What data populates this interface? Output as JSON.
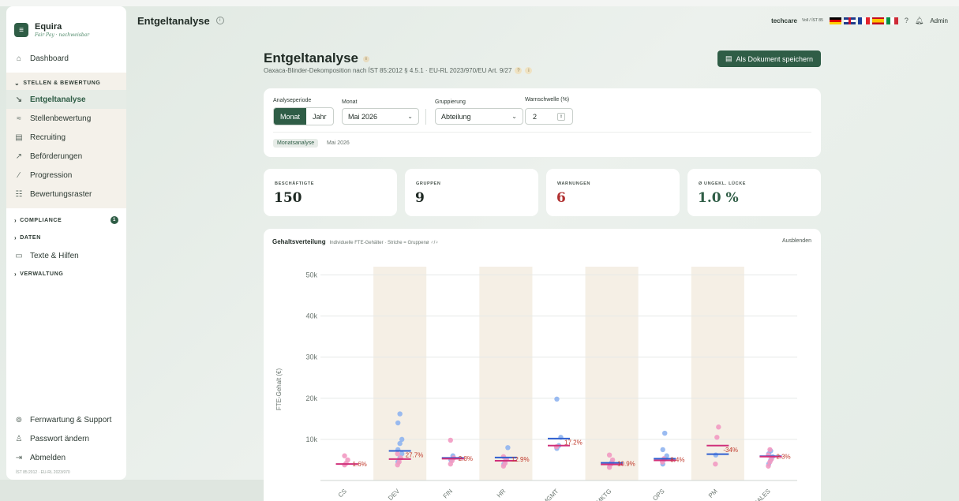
{
  "app": {
    "name": "Equira",
    "tagline": "Fair Pay · nachweisbar",
    "logo_glyph": "≡"
  },
  "topbar": {
    "title": "Entgeltanalyse",
    "tenant": "techcare",
    "norm": "Voll / ÍST 85",
    "help": "?",
    "user": "Admin",
    "flags": [
      "de",
      "gb",
      "fr",
      "es",
      "it"
    ]
  },
  "sidebar": {
    "dashboard": "Dashboard",
    "group_stellen": "STELLEN & BEWERTUNG",
    "items": [
      {
        "label": "Entgeltanalyse",
        "icon": "chart-icon",
        "glyph": "↘",
        "active": true
      },
      {
        "label": "Stellenbewertung",
        "icon": "layers-icon",
        "glyph": "≈",
        "active": false
      },
      {
        "label": "Recruiting",
        "icon": "briefcase-icon",
        "glyph": "▤",
        "active": false
      },
      {
        "label": "Beförderungen",
        "icon": "trend-up-icon",
        "glyph": "↗",
        "active": false
      },
      {
        "label": "Progression",
        "icon": "slash-icon",
        "glyph": "∕",
        "active": false
      },
      {
        "label": "Bewertungsraster",
        "icon": "grid-icon",
        "glyph": "☷",
        "active": false
      }
    ],
    "compliance": "COMPLIANCE",
    "compliance_badge": "1",
    "daten": "DATEN",
    "texte": "Texte & Hilfen",
    "verwaltung": "VERWALTUNG",
    "support": "Fernwartung & Support",
    "password": "Passwort ändern",
    "logout": "Abmelden",
    "footnote": "ÍST 85:2012 · EU-RL 2023/970"
  },
  "page": {
    "title": "Entgeltanalyse",
    "subtitle": "Oaxaca-Blinder-Dekomposition nach ÍST 85:2012 § 4.5.1 · EU-RL 2023/970/EU Art. 9/27",
    "save_label": "Als Dokument speichern"
  },
  "filters": {
    "period_label": "Analyseperiode",
    "period_options": [
      "Monat",
      "Jahr"
    ],
    "period_selected": "Monat",
    "month_label": "Monat",
    "month_value": "Mai 2026",
    "grouping_label": "Gruppierung",
    "grouping_value": "Abteilung",
    "threshold_label": "Warnschwelle (%)",
    "threshold_value": "2",
    "chip": "Monatsanalyse",
    "chip_text": "Mai 2026"
  },
  "stats": [
    {
      "label": "BESCHÄFTIGTE",
      "value": "150"
    },
    {
      "label": "GRUPPEN",
      "value": "9"
    },
    {
      "label": "WARNUNGEN",
      "value": "6"
    },
    {
      "label": "Ø UNGEKL. LÜCKE",
      "value": "1.0 %"
    }
  ],
  "chart": {
    "title": "Gehaltsverteilung",
    "description": "Individuelle FTE-Gehälter · Striche = Gruppenø ♂/♀",
    "hide_label": "Ausblenden"
  },
  "colors": {
    "accent": "#2f5d46",
    "male": "#2f5fd0",
    "female": "#d0307a",
    "male_point": "#8fb4f0",
    "female_point": "#f29ac2",
    "gap_label": "#c0392b",
    "band": "#f5efe5"
  },
  "chart_data": {
    "type": "scatter",
    "title": "",
    "xlabel": "",
    "ylabel": "FTE-Gehalt (€)",
    "ylim": [
      0,
      52000
    ],
    "yticks": [
      "10k",
      "20k",
      "30k",
      "40k",
      "50k"
    ],
    "ytick_values": [
      10000,
      20000,
      30000,
      40000,
      50000
    ],
    "grid": true,
    "groups": [
      {
        "name": "CS",
        "banded": false,
        "male_mean": null,
        "female_mean": 4000,
        "gap": "1.6%",
        "male_points": [],
        "female_points": [
          3800,
          4200,
          5000,
          6000
        ]
      },
      {
        "name": "DEV",
        "banded": true,
        "male_mean": 7200,
        "female_mean": 5200,
        "gap": "27.7%",
        "male_points": [
          4500,
          5500,
          6500,
          7500,
          9000,
          10000,
          14000,
          16200
        ],
        "female_points": [
          3800,
          4500,
          5500,
          6500
        ]
      },
      {
        "name": "FIN",
        "banded": false,
        "male_mean": 5500,
        "female_mean": 5300,
        "gap": "2.8%",
        "male_points": [
          5000,
          6000
        ],
        "female_points": [
          4000,
          4800,
          5500,
          9800
        ]
      },
      {
        "name": "HR",
        "banded": true,
        "male_mean": 5600,
        "female_mean": 4800,
        "gap": "12.9%",
        "male_points": [
          4000,
          5000,
          8000
        ],
        "female_points": [
          3500,
          4200,
          5200,
          5800
        ]
      },
      {
        "name": "MGMT",
        "banded": false,
        "male_mean": 10200,
        "female_mean": 8500,
        "gap": "17.2%",
        "male_points": [
          7800,
          8500,
          10500,
          19800
        ],
        "female_points": [
          8200
        ]
      },
      {
        "name": "MKTG",
        "banded": true,
        "male_mean": 4300,
        "female_mean": 3900,
        "gap": "10.9%",
        "male_points": [
          3800,
          4400
        ],
        "female_points": [
          3200,
          4000,
          5000,
          6200
        ]
      },
      {
        "name": "OPS",
        "banded": false,
        "male_mean": 5300,
        "female_mean": 4900,
        "gap": "8.4%",
        "male_points": [
          4000,
          5200,
          6000,
          7500,
          11500
        ],
        "female_points": [
          4500,
          5300
        ]
      },
      {
        "name": "PM",
        "banded": true,
        "male_mean": 6400,
        "female_mean": 8500,
        "gap": "-34%",
        "male_points": [
          6200
        ],
        "female_points": [
          4000,
          10500,
          13000
        ]
      },
      {
        "name": "SALES",
        "banded": false,
        "male_mean": 5900,
        "female_mean": 5800,
        "gap": "2.3%",
        "male_points": [
          4000,
          5000,
          5800,
          6500,
          7200
        ],
        "female_points": [
          3500,
          4500,
          5200,
          6200,
          7500
        ]
      }
    ]
  }
}
